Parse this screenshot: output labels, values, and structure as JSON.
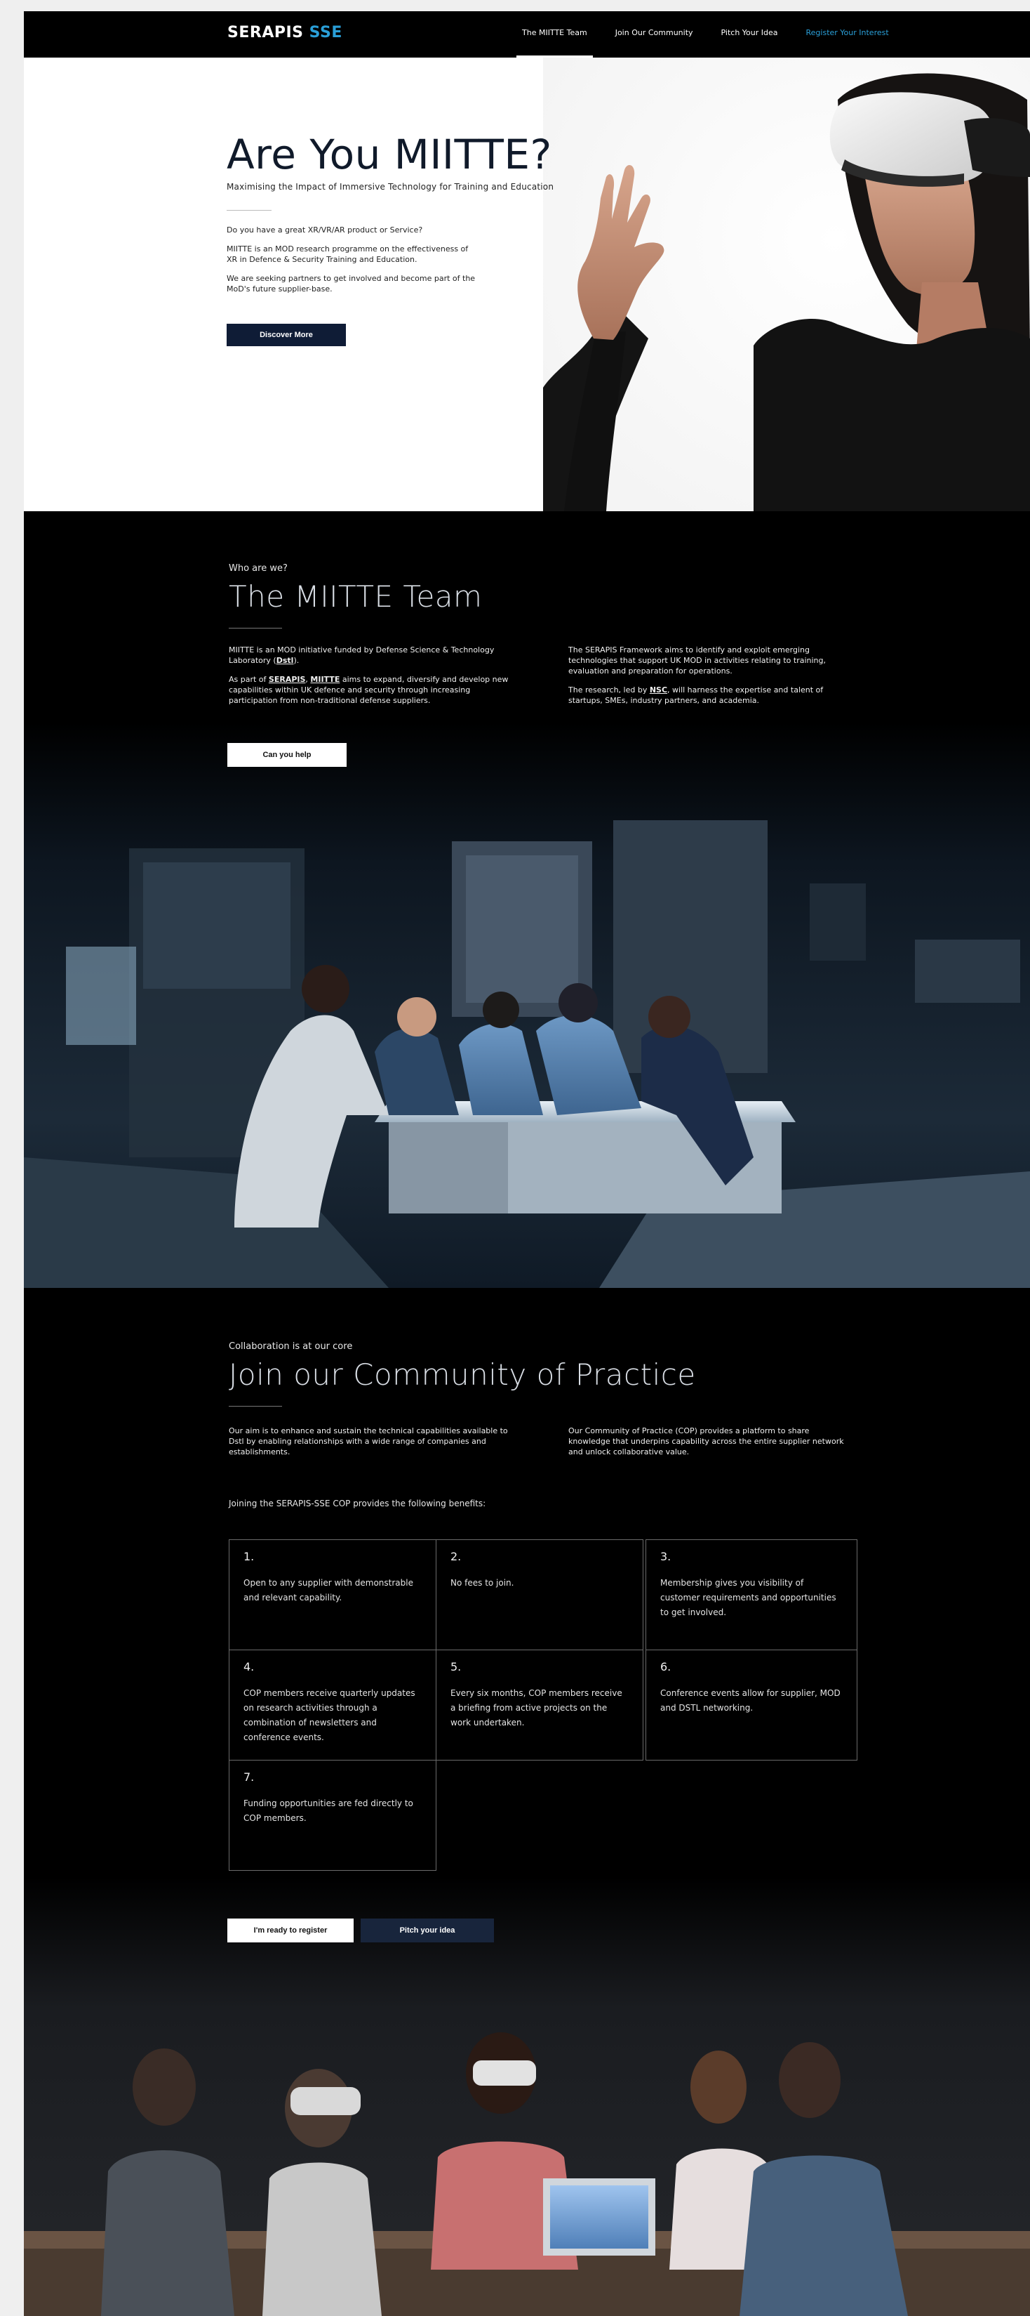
{
  "nav": {
    "logo_main": "SERAPIS",
    "logo_accent": "SSE",
    "links": [
      {
        "label": "The MIITTE Team"
      },
      {
        "label": "Join Our Community"
      },
      {
        "label": "Pitch Your Idea"
      },
      {
        "label": "Register Your Interest"
      }
    ]
  },
  "hero": {
    "title": "Are You MIITTE?",
    "subtitle": "Maximising the Impact of Immersive Technology for Training and Education",
    "paragraphs": [
      "Do you have a great XR/VR/AR product or Service?",
      "MIITTE is an MOD research programme on the effectiveness of XR in Defence & Security Training and Education.",
      "We are seeking partners to get involved and become part of the MoD's future supplier-base."
    ],
    "button": "Discover More"
  },
  "team": {
    "kicker": "Who are we?",
    "title": "The MIITTE Team",
    "left_p1_a": "MIITTE is an MOD initiative funded by Defense Science & Technology Laboratory (",
    "left_p1_link": "Dstl",
    "left_p1_b": ").",
    "left_p2_a": "As part of ",
    "left_p2_link1": "SERAPIS",
    "left_p2_mid": ", ",
    "left_p2_link2": "MIITTE",
    "left_p2_b": " aims to expand, diversify and develop new capabilities within UK defence and security through increasing participation from non-traditional defense suppliers.",
    "right_p1": "The SERAPIS Framework aims to identify and exploit emerging technologies that support UK MOD in activities relating to training, evaluation and preparation for operations.",
    "right_p2_a": "The research, led by ",
    "right_p2_link": "NSC",
    "right_p2_b": ", will harness the expertise and talent of startups, SMEs, industry partners, and academia.",
    "button": "Can you help"
  },
  "community": {
    "kicker": "Collaboration is at our core",
    "title": "Join our Community of Practice",
    "left_p": "Our aim is to enhance and sustain the technical capabilities available to Dstl by enabling relationships with a wide range of companies and establishments.",
    "right_p": "Our Community of Practice (COP) provides a platform to share knowledge that underpins capability across the entire supplier network and unlock collaborative value.",
    "benefits_intro": "Joining the SERAPIS-SSE COP provides the following benefits:",
    "benefits": [
      {
        "num": "1.",
        "text": "Open to any supplier with demonstrable and relevant capability."
      },
      {
        "num": "2.",
        "text": "No fees to join."
      },
      {
        "num": "3.",
        "text": "Membership gives you visibility of customer requirements and opportunities to get involved."
      },
      {
        "num": "4.",
        "text": "COP members receive quarterly updates on research activities through a combination of newsletters and conference events."
      },
      {
        "num": "5.",
        "text": "Every six months, COP members receive a briefing from active projects on the work undertaken."
      },
      {
        "num": "6.",
        "text": "Conference events allow for supplier, MOD and DSTL networking."
      },
      {
        "num": "7.",
        "text": "Funding opportunities are fed directly to COP members."
      }
    ],
    "button_register": "I'm ready to register",
    "button_pitch": "Pitch your idea"
  },
  "colors": {
    "accent": "#2a9fd8",
    "navy_button": "#0f1c36",
    "background": "#000000"
  }
}
